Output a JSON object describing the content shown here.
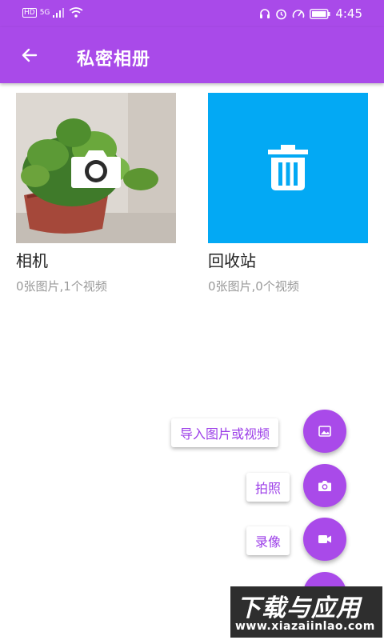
{
  "status_bar": {
    "left_badge": "HD",
    "signal_type": "5G",
    "time": "4:45",
    "icons": [
      "headset-icon",
      "alarm-icon",
      "speed-icon",
      "battery-icon"
    ]
  },
  "app_bar": {
    "title": "私密相册",
    "back_icon": "arrow-left-icon",
    "color": "#a94ae9"
  },
  "albums": [
    {
      "name": "相机",
      "count": "0张图片,1个视频",
      "icon": "camera-icon"
    },
    {
      "name": "回收站",
      "count": "0张图片,0个视频",
      "icon": "trash-icon",
      "color": "#03a9f4"
    }
  ],
  "fab_menu": {
    "import_label": "导入图片或视频",
    "photo_label": "拍照",
    "video_label": "录像",
    "icons": [
      "image-icon",
      "camera-icon",
      "videocam-icon",
      "close-icon"
    ]
  },
  "watermark": {
    "line1": "下载与应用",
    "line2": "www.xiazaiinlao.com"
  }
}
